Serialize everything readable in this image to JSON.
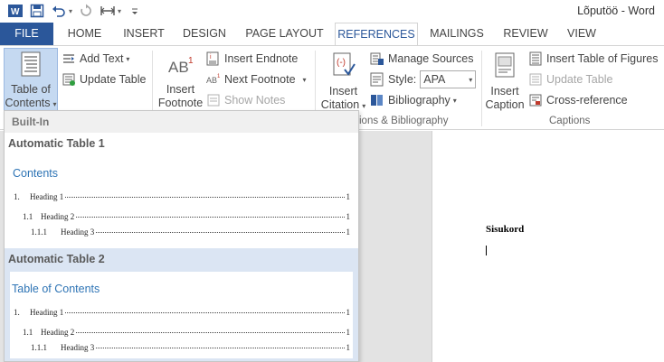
{
  "window": {
    "title": "Lõputöö - Word"
  },
  "tabs": {
    "file": "FILE",
    "home": "HOME",
    "insert": "INSERT",
    "design": "DESIGN",
    "page_layout": "PAGE LAYOUT",
    "references": "REFERENCES",
    "mailings": "MAILINGS",
    "review": "REVIEW",
    "view": "VIEW"
  },
  "ribbon": {
    "toc": {
      "line1": "Table of",
      "line2": "Contents"
    },
    "add_text": "Add Text",
    "update_table": "Update Table",
    "insert_footnote": {
      "line1": "Insert",
      "line2": "Footnote"
    },
    "insert_endnote": "Insert Endnote",
    "next_footnote": "Next Footnote",
    "show_notes": "Show Notes",
    "insert_citation": {
      "line1": "Insert",
      "line2": "Citation"
    },
    "manage_sources": "Manage Sources",
    "style_label": "Style:",
    "style_value": "APA",
    "bibliography": "Bibliography",
    "citations_group_label": "ions & Bibliography",
    "insert_caption": {
      "line1": "Insert",
      "line2": "Caption"
    },
    "insert_table_of_figures": "Insert Table of Figures",
    "update_table_figures": "Update Table",
    "cross_reference": "Cross-reference",
    "captions_group_label": "Captions"
  },
  "gallery": {
    "section": "Built-In",
    "items": [
      {
        "title": "Automatic Table 1",
        "heading": "Contents",
        "lines": [
          {
            "num": "1.",
            "text": "Heading 1",
            "page": "1"
          },
          {
            "num": "1.1",
            "text": "Heading 2",
            "page": "1"
          },
          {
            "num": "1.1.1",
            "text": "Heading 3",
            "page": "1"
          }
        ]
      },
      {
        "title": "Automatic Table 2",
        "heading": "Table of Contents",
        "lines": [
          {
            "num": "1.",
            "text": "Heading 1",
            "page": "1"
          },
          {
            "num": "1.1",
            "text": "Heading 2",
            "page": "1"
          },
          {
            "num": "1.1.1",
            "text": "Heading 3",
            "page": "1"
          }
        ]
      }
    ]
  },
  "document": {
    "heading": "Sisukord"
  }
}
